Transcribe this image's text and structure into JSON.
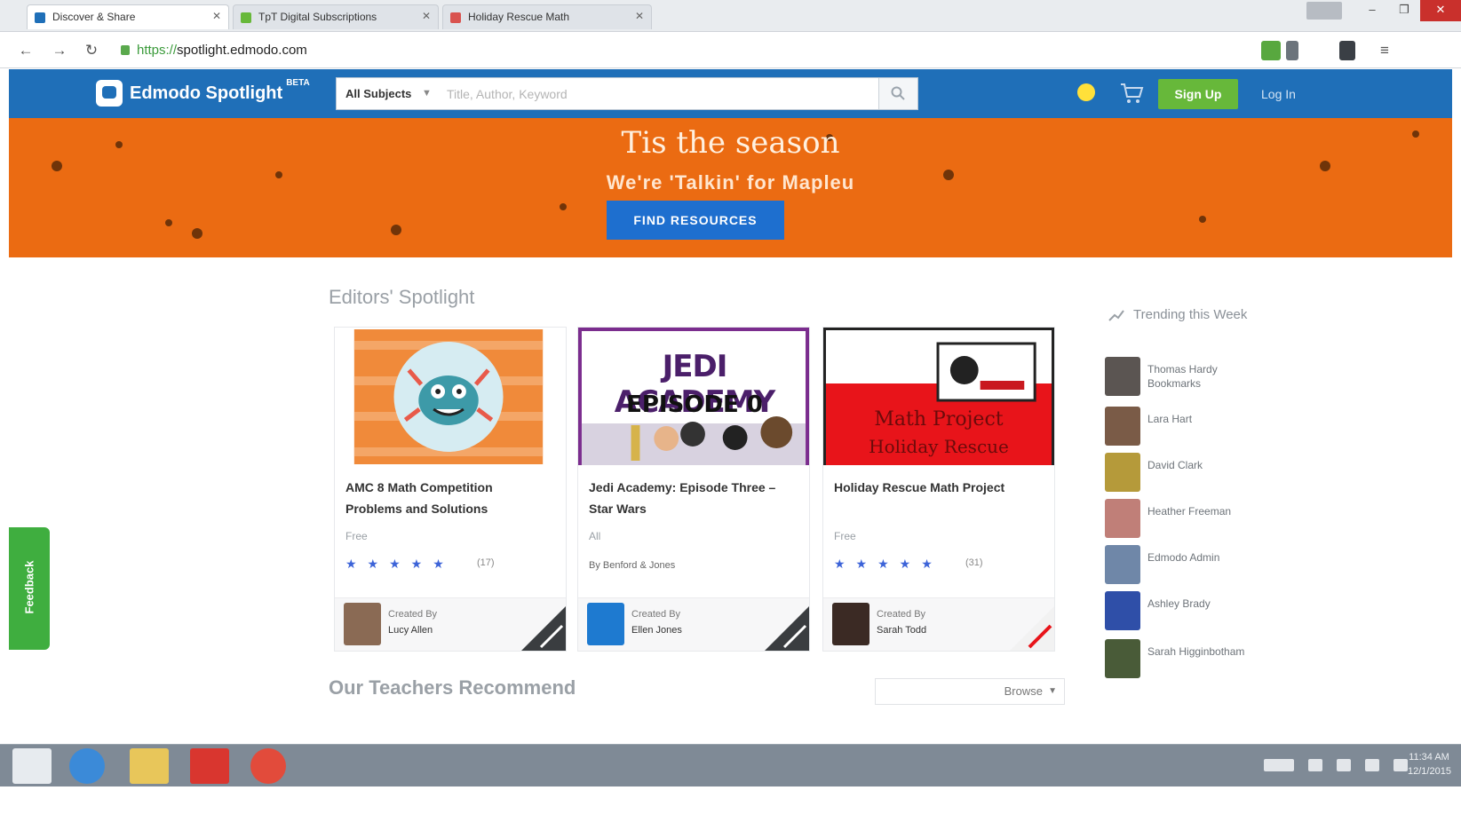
{
  "browser": {
    "tabs": [
      {
        "label": "Discover & Share",
        "active": true,
        "favicon_color": "#1f6fb8"
      },
      {
        "label": "TpT Digital Subscriptions",
        "active": false,
        "favicon_color": "#67b83a"
      },
      {
        "label": "Holiday Rescue Math",
        "active": false,
        "favicon_color": "#d9534f"
      }
    ],
    "url_scheme": "https://",
    "url_host": "spotlight.edmodo.com",
    "window_buttons": [
      "–",
      "❐",
      "✕"
    ]
  },
  "header": {
    "logo_text": "Edmodo Spotlight",
    "logo_sup": "BETA",
    "search_scope": "All Subjects",
    "search_placeholder": "Title, Author, Keyword",
    "signup_label": "Sign Up",
    "login_label": "Log In",
    "colors": {
      "bar": "#1f6fb8",
      "signup": "#67b83a"
    }
  },
  "banner": {
    "title": "Tis the season",
    "subtitle": "We're 'Talkin' for Mapleu",
    "button_label": "FIND RESOURCES",
    "color": "#eb6b12"
  },
  "main": {
    "section_title": "Editors' Spotlight",
    "cards": [
      {
        "title": "AMC 8 Math Competition Problems and Solutions",
        "grade": "Free",
        "rating": 5,
        "reviews": "(17)",
        "by_label": "Created By",
        "author": "Lucy Allen",
        "thumb_theme": "monster"
      },
      {
        "title": "Jedi Academy: Episode Three – Star Wars",
        "grade": "All",
        "note": "By Benford & Jones",
        "by_label": "Created By",
        "author": "Ellen Jones",
        "thumb_caption_1": "JEDI ACADEMY",
        "thumb_caption_2": "EPISODE 0",
        "thumb_theme": "jedi"
      },
      {
        "title": "Holiday Rescue Math Project",
        "grade": "Free",
        "rating": 5,
        "reviews": "(31)",
        "by_label": "Created By",
        "author": "Sarah Todd",
        "thumb_caption_1": "Math Project",
        "thumb_caption_2": "Holiday Rescue",
        "thumb_theme": "holiday"
      }
    ],
    "recommend_title": "Our Teachers Recommend",
    "browse_label": "Browse"
  },
  "trending": {
    "title": "Trending this Week",
    "items": [
      {
        "name": "Thomas Hardy Bookmarks",
        "color": "#5b5552"
      },
      {
        "name": "Lara Hart",
        "color": "#7a5b47"
      },
      {
        "name": "David Clark",
        "color": "#b59a3a"
      },
      {
        "name": "Heather Freeman",
        "color": "#c07f78"
      },
      {
        "name": "Edmodo Admin",
        "color": "#6f87a8"
      },
      {
        "name": "Ashley Brady",
        "color": "#2f4fa8"
      },
      {
        "name": "Sarah Higginbotham",
        "color": "#495b38"
      }
    ]
  },
  "feedback_label": "Feedback",
  "taskbar": {
    "time": "11:34 AM",
    "date": "12/1/2015"
  }
}
